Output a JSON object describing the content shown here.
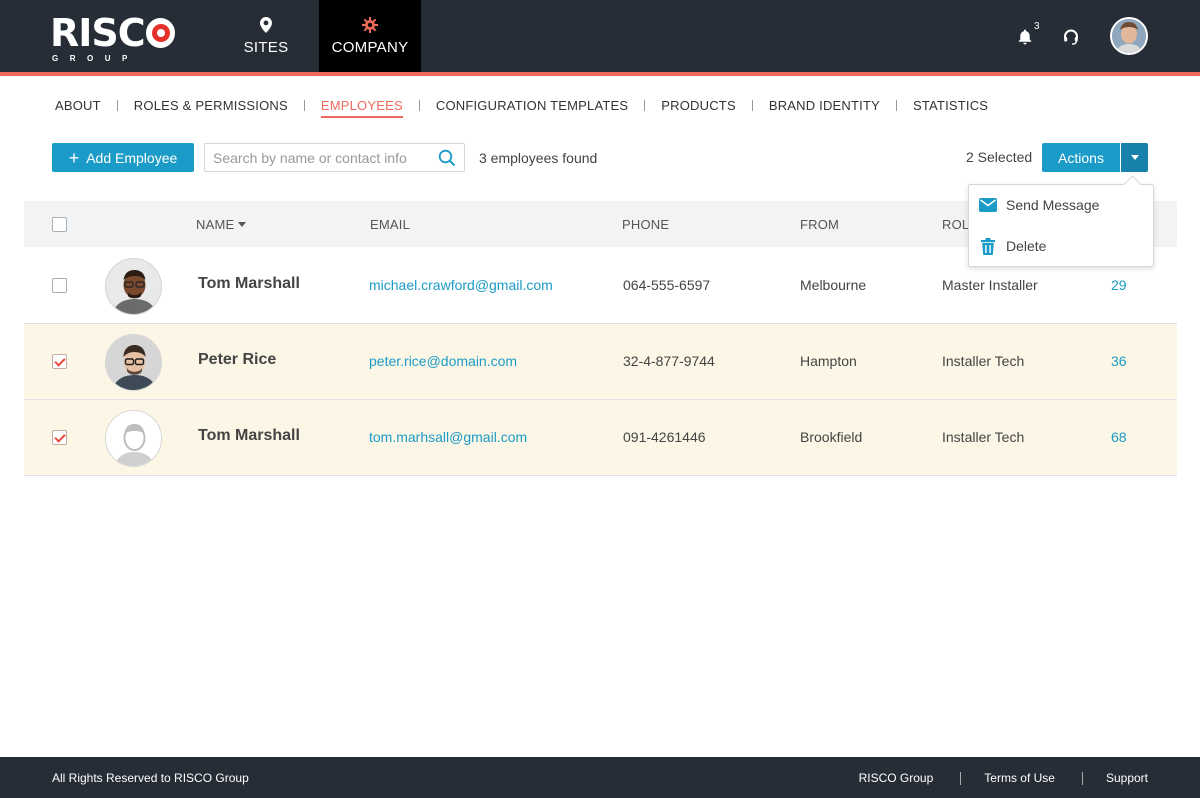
{
  "brand": {
    "logo_text": "RISC",
    "logo_sub": "GROUP"
  },
  "nav": {
    "sites_label": "SITES",
    "company_label": "COMPANY",
    "notification_count": "3"
  },
  "tabs": [
    {
      "label": "ABOUT"
    },
    {
      "label": "ROLES & PERMISSIONS"
    },
    {
      "label": "EMPLOYEES",
      "active": true
    },
    {
      "label": "CONFIGURATION TEMPLATES"
    },
    {
      "label": "PRODUCTS"
    },
    {
      "label": "BRAND IDENTITY"
    },
    {
      "label": "STATISTICS"
    }
  ],
  "toolbar": {
    "add_label": "Add Employee",
    "search_placeholder": "Search by name or contact info",
    "found_text": "3 employees found",
    "selected_text": "2 Selected",
    "actions_label": "Actions"
  },
  "actions_menu": [
    {
      "label": "Send Message",
      "icon": "envelope-icon"
    },
    {
      "label": "Delete",
      "icon": "trash-icon"
    }
  ],
  "table": {
    "headers": {
      "name": "NAME",
      "email": "EMAIL",
      "phone": "PHONE",
      "from": "FROM",
      "role": "ROLE"
    },
    "rows": [
      {
        "name": "Tom Marshall",
        "email": "michael.crawford@gmail.com",
        "phone": "064-555-6597",
        "from": "Melbourne",
        "role": "Master Installer",
        "count": "29",
        "selected": false,
        "avatar": "photo-dark-skin"
      },
      {
        "name": "Peter Rice",
        "email": "peter.rice@domain.com",
        "phone": "32-4-877-9744",
        "from": "Hampton",
        "role": "Installer Tech",
        "count": "36",
        "selected": true,
        "avatar": "photo-glasses"
      },
      {
        "name": "Tom Marshall",
        "email": "tom.marhsall@gmail.com",
        "phone": "091-4261446",
        "from": "Brookfield",
        "role": "Installer Tech",
        "count": "68",
        "selected": true,
        "avatar": "placeholder"
      }
    ]
  },
  "footer": {
    "copyright": "All Rights Reserved to RISCO Group",
    "links": [
      "RISCO Group",
      "Terms of Use",
      "Support"
    ]
  },
  "colors": {
    "header_bg": "#262d36",
    "accent_red": "#ef6a5c",
    "primary_blue": "#1b9bc8",
    "selected_row": "#fcf6e6"
  }
}
